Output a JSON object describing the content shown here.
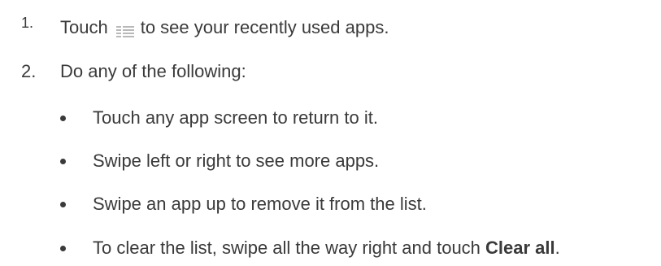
{
  "steps": [
    {
      "number": "1.",
      "text_before_icon": "Touch",
      "icon": "recent-apps-icon",
      "text_after_icon": "to see your recently used apps."
    },
    {
      "number": "2.",
      "text": "Do any of the following:"
    }
  ],
  "bullets": [
    {
      "text": "Touch any app screen to return to it."
    },
    {
      "text": "Swipe left or right to see more apps."
    },
    {
      "text": "Swipe an app up to remove it from the list."
    },
    {
      "text_before_bold": "To clear the list, swipe all the way right and touch ",
      "bold": "Clear all",
      "text_after_bold": "."
    }
  ],
  "colors": {
    "text": "#3a3a3a",
    "icon": "#b9b9b9"
  }
}
